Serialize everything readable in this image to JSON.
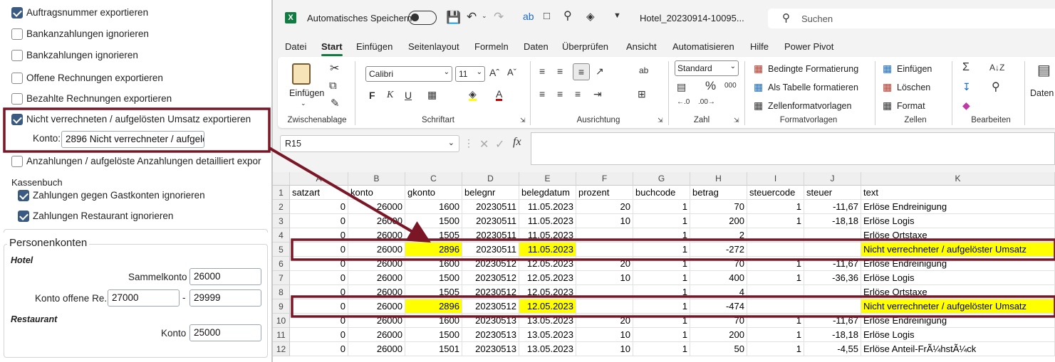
{
  "left": {
    "checkboxes": [
      {
        "label": "Auftragsnummer exportieren",
        "checked": true
      },
      {
        "label": "Bankanzahlungen ignorieren",
        "checked": false
      },
      {
        "label": "Bankzahlungen ignorieren",
        "checked": false
      },
      {
        "label": "Offene Rechnungen exportieren",
        "checked": false
      },
      {
        "label": "Bezahlte Rechnungen exportieren",
        "checked": false
      },
      {
        "label": "Nicht verrechneten / aufgelösten Umsatz exportieren",
        "checked": true
      },
      {
        "label": "Anzahlungen / aufgelöste Anzahlungen detailliert expor",
        "checked": false
      }
    ],
    "konto_label": "Konto:",
    "konto_value": "2896 Nicht verrechneter / aufgelöst",
    "kassenbuch_title": "Kassenbuch",
    "kassenbuch_items": [
      {
        "label": "Zahlungen gegen Gastkonten ignorieren",
        "checked": true
      },
      {
        "label": "Zahlungen Restaurant ignorieren",
        "checked": true
      }
    ],
    "personenkonten_title": "Personenkonten",
    "hotel_label": "Hotel",
    "sammelkonto_label": "Sammelkonto",
    "sammelkonto_value": "26000",
    "konto_offene_label": "Konto offene Re.",
    "konto_offene_from": "27000",
    "konto_offene_dash": "-",
    "konto_offene_to": "29999",
    "restaurant_label": "Restaurant",
    "restaurant_konto_label": "Konto",
    "restaurant_konto_value": "25000"
  },
  "excel": {
    "autosave_label": "Automatisches Speichern",
    "file_name": "Hotel_20230914-10095...",
    "search_placeholder": "Suchen",
    "tabs": [
      "Datei",
      "Start",
      "Einfügen",
      "Seitenlayout",
      "Formeln",
      "Daten",
      "Überprüfen",
      "Ansicht",
      "Automatisieren",
      "Hilfe",
      "Power Pivot"
    ],
    "active_tab": "Start",
    "clipboard": {
      "paste_label": "Einfügen",
      "group_label": "Zwischenablage"
    },
    "font": {
      "name": "Calibri",
      "size": "11",
      "group_label": "Schriftart"
    },
    "alignment_group_label": "Ausrichtung",
    "number": {
      "format": "Standard",
      "group_label": "Zahl"
    },
    "styles": {
      "conditional": "Bedingte Formatierung",
      "as_table": "Als Tabelle formatieren",
      "cell_styles": "Zellenformatvorlagen",
      "group_label": "Formatvorlagen"
    },
    "cells": {
      "insert": "Einfügen",
      "delete": "Löschen",
      "format": "Format",
      "group_label": "Zellen"
    },
    "editing_group_label": "Bearbeiten",
    "data_label": "Daten",
    "name_box": "R15",
    "fx": "fx",
    "columns": [
      "A",
      "B",
      "C",
      "D",
      "E",
      "F",
      "G",
      "H",
      "I",
      "J",
      "K"
    ],
    "rows": [
      {
        "n": "1",
        "cells": [
          "satzart",
          "konto",
          "gkonto",
          "belegnr",
          "belegdatum",
          "prozent",
          "buchcode",
          "betrag",
          "steuercode",
          "steuer",
          "text"
        ]
      },
      {
        "n": "2",
        "cells": [
          "0",
          "26000",
          "1600",
          "20230511",
          "11.05.2023",
          "20",
          "1",
          "70",
          "1",
          "-11,67",
          "Erlöse Endreinigung"
        ]
      },
      {
        "n": "3",
        "cells": [
          "0",
          "26000",
          "1500",
          "20230511",
          "11.05.2023",
          "10",
          "1",
          "200",
          "1",
          "-18,18",
          "Erlöse Logis"
        ]
      },
      {
        "n": "4",
        "cells": [
          "0",
          "26000",
          "1505",
          "20230511",
          "11.05.2023",
          "",
          "1",
          "2",
          "",
          "",
          "Erlöse Ortstaxe"
        ]
      },
      {
        "n": "5",
        "cells": [
          "0",
          "26000",
          "2896",
          "20230511",
          "11.05.2023",
          "",
          "1",
          "-272",
          "",
          "",
          "Nicht verrechneter / aufgelöster Umsatz"
        ]
      },
      {
        "n": "6",
        "cells": [
          "0",
          "26000",
          "1600",
          "20230512",
          "12.05.2023",
          "20",
          "1",
          "70",
          "1",
          "-11,67",
          "Erlöse Endreinigung"
        ]
      },
      {
        "n": "7",
        "cells": [
          "0",
          "26000",
          "1500",
          "20230512",
          "12.05.2023",
          "10",
          "1",
          "400",
          "1",
          "-36,36",
          "Erlöse Logis"
        ]
      },
      {
        "n": "8",
        "cells": [
          "0",
          "26000",
          "1505",
          "20230512",
          "12.05.2023",
          "",
          "1",
          "4",
          "",
          "",
          "Erlöse Ortstaxe"
        ]
      },
      {
        "n": "9",
        "cells": [
          "0",
          "26000",
          "2896",
          "20230512",
          "12.05.2023",
          "",
          "1",
          "-474",
          "",
          "",
          "Nicht verrechneter / aufgelöster Umsatz"
        ]
      },
      {
        "n": "10",
        "cells": [
          "0",
          "26000",
          "1600",
          "20230513",
          "13.05.2023",
          "20",
          "1",
          "70",
          "1",
          "-11,67",
          "Erlöse Endreinigung"
        ]
      },
      {
        "n": "11",
        "cells": [
          "0",
          "26000",
          "1500",
          "20230513",
          "13.05.2023",
          "10",
          "1",
          "200",
          "1",
          "-18,18",
          "Erlöse Logis"
        ]
      },
      {
        "n": "12",
        "cells": [
          "0",
          "26000",
          "1501",
          "20230513",
          "13.05.2023",
          "10",
          "1",
          "50",
          "1",
          "-4,55",
          "Erlöse Anteil-FrÃ¼hstÃ¼ck"
        ]
      }
    ],
    "highlight_rows": [
      "5",
      "9"
    ]
  },
  "colors": {
    "excel_green": "#107c41",
    "highlight": "#ffff00",
    "annotation": "#7b1626",
    "checkbox": "#3b5a82"
  }
}
